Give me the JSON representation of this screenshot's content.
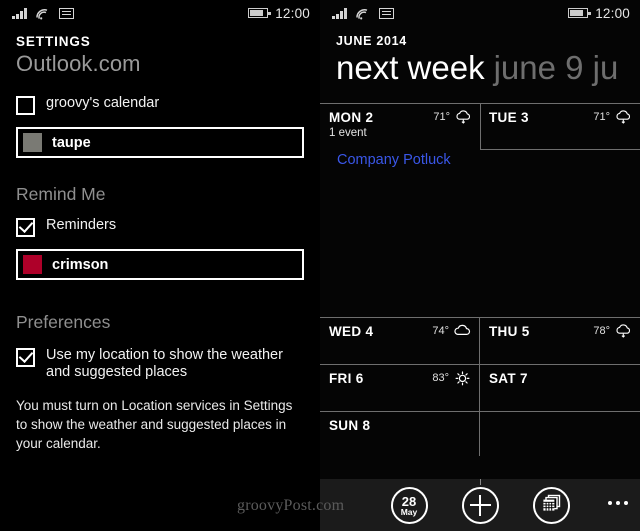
{
  "status_bar": {
    "signal_icon": "signal-bars-icon",
    "wifi_icon": "wifi-icon",
    "sim_icon": "sim-card-icon",
    "battery_icon": "battery-icon",
    "time": "12:00"
  },
  "settings_panel": {
    "title": "SETTINGS",
    "account": "Outlook.com",
    "calendar_checkbox": {
      "label": "groovy's calendar",
      "checked": false
    },
    "calendar_color": {
      "name": "taupe",
      "hex": "#7a7a74"
    },
    "remind_section": {
      "heading": "Remind Me",
      "checkbox": {
        "label": "Reminders",
        "checked": true
      },
      "color": {
        "name": "crimson",
        "hex": "#ae0029"
      }
    },
    "preferences_section": {
      "heading": "Preferences",
      "checkbox": {
        "label": "Use my location to show the weather and suggested places",
        "checked": true
      },
      "hint": "You must turn on Location services in Settings to show the weather and suggested places in your calendar."
    }
  },
  "calendar_panel": {
    "month_label": "JUNE 2014",
    "pivot_active": "next week",
    "pivot_inactive": "june 9 ju",
    "event_color": "#3a57e8",
    "days": [
      {
        "name": "MON 2",
        "temp": "71°",
        "weather": "cloud-rain-icon",
        "event_count": "1 event",
        "event": "Company Potluck"
      },
      {
        "name": "TUE 3",
        "temp": "71°",
        "weather": "cloud-rain-icon",
        "event_count": "",
        "event": ""
      },
      {
        "name": "WED 4",
        "temp": "74°",
        "weather": "cloud-icon",
        "event_count": "",
        "event": ""
      },
      {
        "name": "THU 5",
        "temp": "78°",
        "weather": "cloud-rain-icon",
        "event_count": "",
        "event": ""
      },
      {
        "name": "FRI 6",
        "temp": "83°",
        "weather": "sun-icon",
        "event_count": "",
        "event": ""
      },
      {
        "name": "SAT 7",
        "temp": "",
        "weather": "",
        "event_count": "",
        "event": ""
      },
      {
        "name": "SUN 8",
        "temp": "",
        "weather": "",
        "event_count": "",
        "event": ""
      }
    ],
    "appbar": {
      "today_day": "28",
      "today_month": "May",
      "today_icon": "today-date-icon",
      "add_icon": "plus-icon",
      "view_icon": "calendar-view-icon",
      "more_icon": "more-ellipsis-icon"
    }
  },
  "watermark": "groovyPost.com"
}
